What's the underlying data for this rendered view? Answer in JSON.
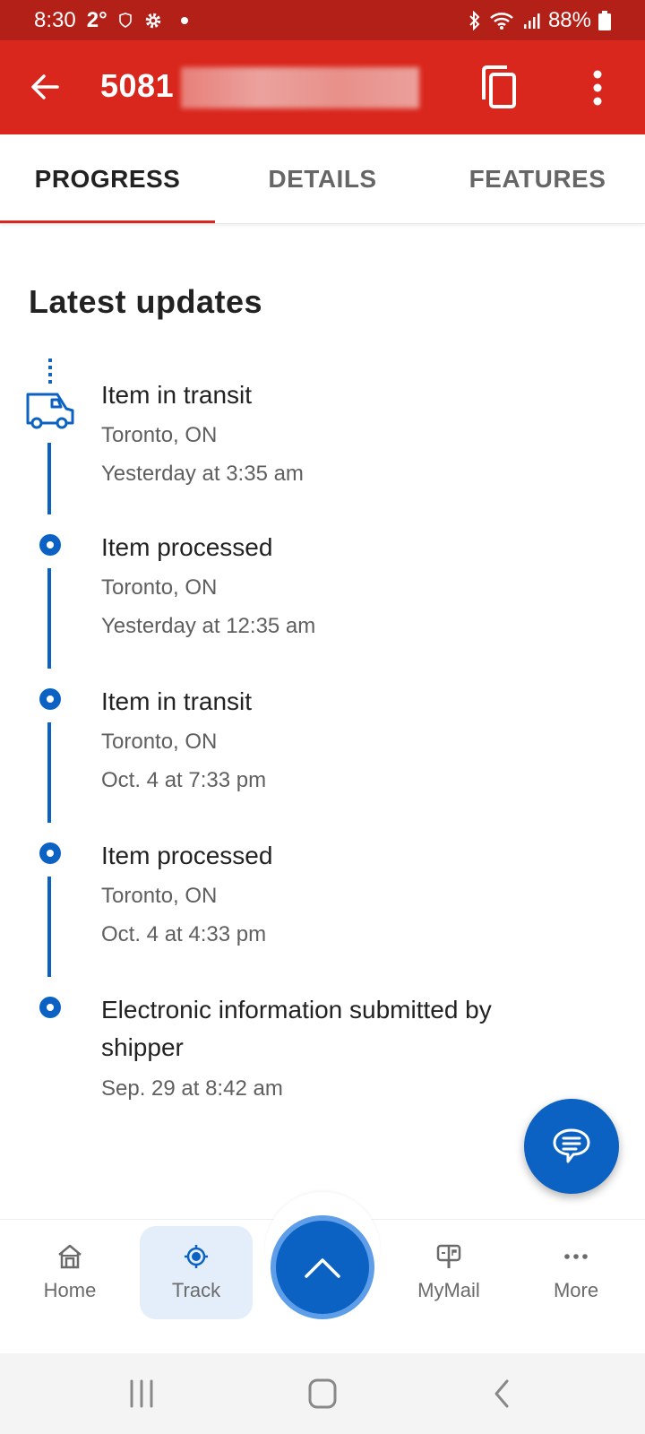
{
  "status_bar": {
    "time": "8:30",
    "temperature": "2°",
    "battery": "88%",
    "icons": [
      "shield-icon",
      "gear-icon",
      "dot-icon",
      "bluetooth-icon",
      "wifi-icon",
      "signal-icon",
      "battery-icon"
    ]
  },
  "app_bar": {
    "tracking_number_visible": "5081",
    "back_icon": "arrow-left-icon",
    "copy_icon": "copy-icon",
    "menu_icon": "more-vertical-icon"
  },
  "tabs": [
    {
      "label": "PROGRESS",
      "active": true
    },
    {
      "label": "DETAILS",
      "active": false
    },
    {
      "label": "FEATURES",
      "active": false
    }
  ],
  "section_title": "Latest updates",
  "events": [
    {
      "title": "Item in transit",
      "location": "Toronto, ON",
      "time": "Yesterday at 3:35 am",
      "icon": "truck-icon"
    },
    {
      "title": "Item processed",
      "location": "Toronto, ON",
      "time": "Yesterday at 12:35 am",
      "icon": "dot-icon"
    },
    {
      "title": "Item in transit",
      "location": "Toronto, ON",
      "time": "Oct. 4 at 7:33 pm",
      "icon": "dot-icon"
    },
    {
      "title": "Item processed",
      "location": "Toronto, ON",
      "time": "Oct. 4 at 4:33 pm",
      "icon": "dot-icon"
    },
    {
      "title": "Electronic information submitted by shipper",
      "location": "",
      "time": "Sep. 29 at 8:42 am",
      "icon": "dot-icon"
    }
  ],
  "bottom_nav": [
    {
      "label": "Home",
      "icon": "home-icon",
      "active": false
    },
    {
      "label": "Track",
      "icon": "target-icon",
      "active": true
    },
    {
      "label": "MyMail",
      "icon": "mailbox-icon",
      "active": false
    },
    {
      "label": "More",
      "icon": "more-horizontal-icon",
      "active": false
    }
  ],
  "colors": {
    "brand_red": "#d9271d",
    "status_red": "#b22018",
    "accent_blue": "#0b62c2"
  }
}
